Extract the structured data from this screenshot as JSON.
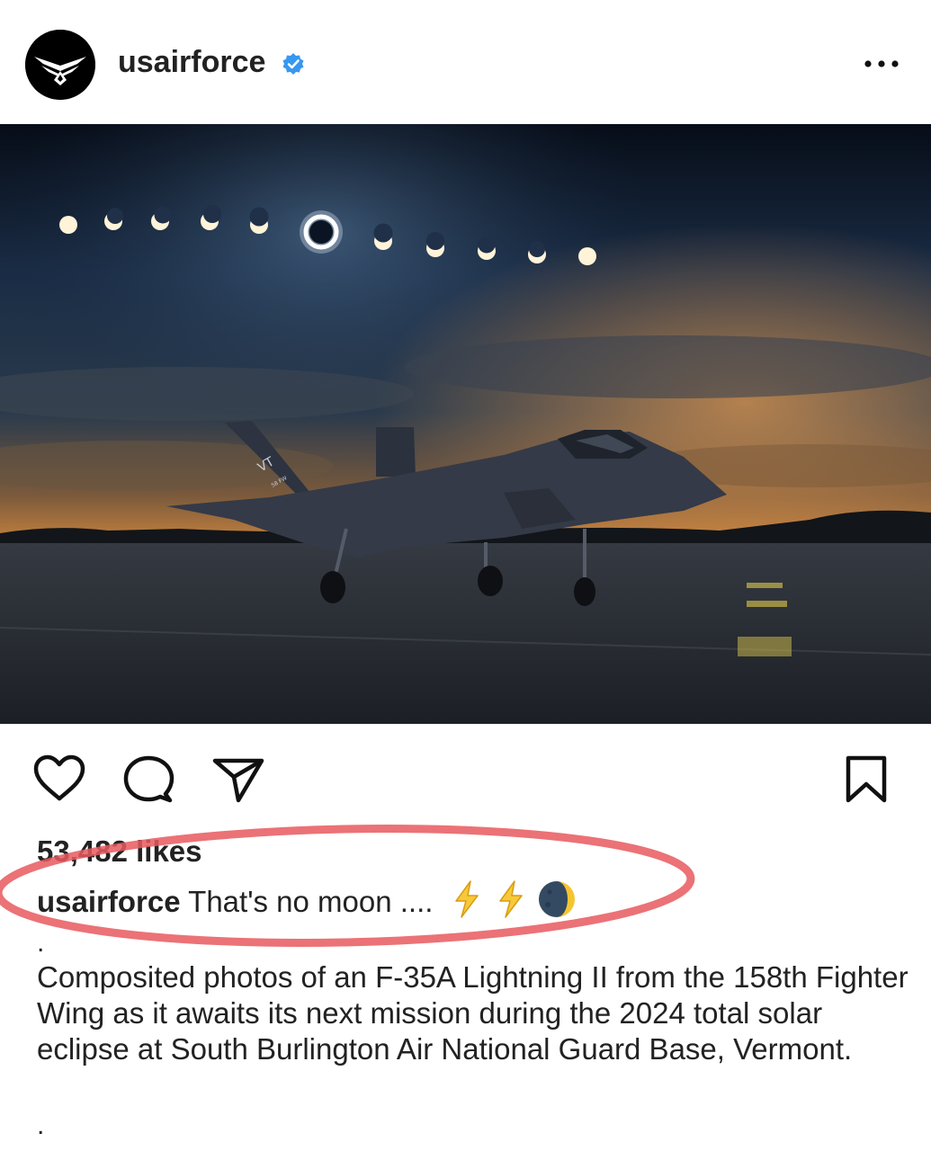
{
  "post": {
    "username": "usairforce",
    "likes": "53,482 likes",
    "caption_user": "usairforce",
    "caption_text": "That's no moon ....",
    "caption_emojis": [
      "lightning-icon",
      "lightning-icon",
      "crescent-moon-icon"
    ],
    "separator_1": ".",
    "description": "Composited photos of an F-35A Lightning II from the 158th Fighter Wing as it awaits its next mission during the 2024 total solar eclipse at South Burlington Air National Guard Base, Vermont.",
    "separator_2": ".",
    "photo_tail_text": [
      "VT",
      "58 FW"
    ]
  },
  "colors": {
    "verified_blue": "#3897f0",
    "annotation_red": "#e8595e",
    "text_dark": "#222222"
  }
}
